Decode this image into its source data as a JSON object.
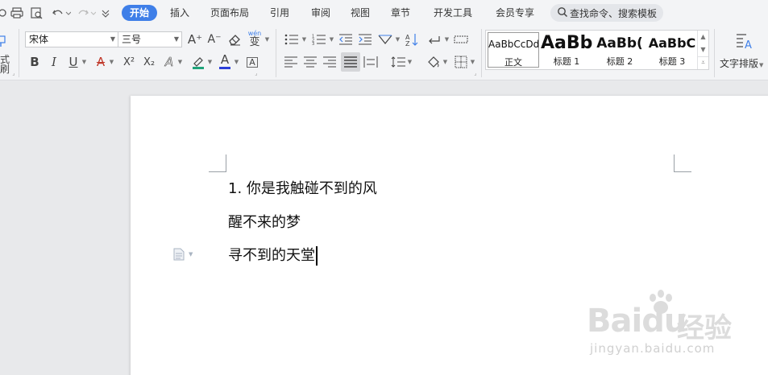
{
  "menu": {
    "tabs": [
      {
        "label": "开始",
        "active": true
      },
      {
        "label": "插入"
      },
      {
        "label": "页面布局"
      },
      {
        "label": "引用"
      },
      {
        "label": "审阅"
      },
      {
        "label": "视图"
      },
      {
        "label": "章节"
      },
      {
        "label": "开发工具"
      },
      {
        "label": "会员专享"
      }
    ],
    "search_placeholder": "查找命令、搜索模板"
  },
  "ribbon": {
    "format_painter_label": "式刷",
    "font_name": "宋体",
    "font_size": "三号",
    "phonetic_label": "wén",
    "phonetic_char": "变",
    "bold": "B",
    "italic": "I",
    "underline": "U",
    "strike": "A",
    "superscript": "X²",
    "subscript": "X₂",
    "text_effect": "A",
    "font_color": "A",
    "char_border": "A",
    "grow_font": "A⁺",
    "shrink_font": "A⁻",
    "styles": [
      {
        "preview": "AaBbCcDd",
        "name": "正文"
      },
      {
        "preview": "AaBb",
        "name": "标题 1"
      },
      {
        "preview": "AaBb(",
        "name": "标题 2"
      },
      {
        "preview": "AaBbC",
        "name": "标题 3"
      }
    ],
    "text_layout_label": "文字排版"
  },
  "document": {
    "lines": [
      "1. 你是我触碰不到的风",
      "醒不来的梦",
      "寻不到的天堂"
    ]
  },
  "watermark": {
    "logo": "Baidu",
    "cn": "经验",
    "url": "jingyan.baidu.com"
  },
  "colors": {
    "accent": "#3f7fe8",
    "highlight": "#1fa37a",
    "font_color": "#2b3fd9",
    "ribbon_bg": "#f3f4f6",
    "doc_bg": "#e8e9eb"
  }
}
